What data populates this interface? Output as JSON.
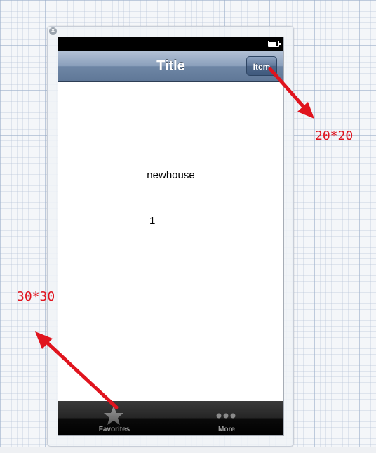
{
  "navigation_bar": {
    "title": "Title",
    "right_button_label": "Item"
  },
  "content": {
    "label_1": "newhouse",
    "label_2": "1"
  },
  "tab_bar": {
    "items": [
      {
        "label": "Favorites",
        "icon": "star-icon"
      },
      {
        "label": "More",
        "icon": "more-dots-icon"
      }
    ]
  },
  "annotations": {
    "nav_item_size": "20*20",
    "tab_icon_size": "30*30",
    "color": "#e0141e"
  },
  "close_glyph": "×"
}
